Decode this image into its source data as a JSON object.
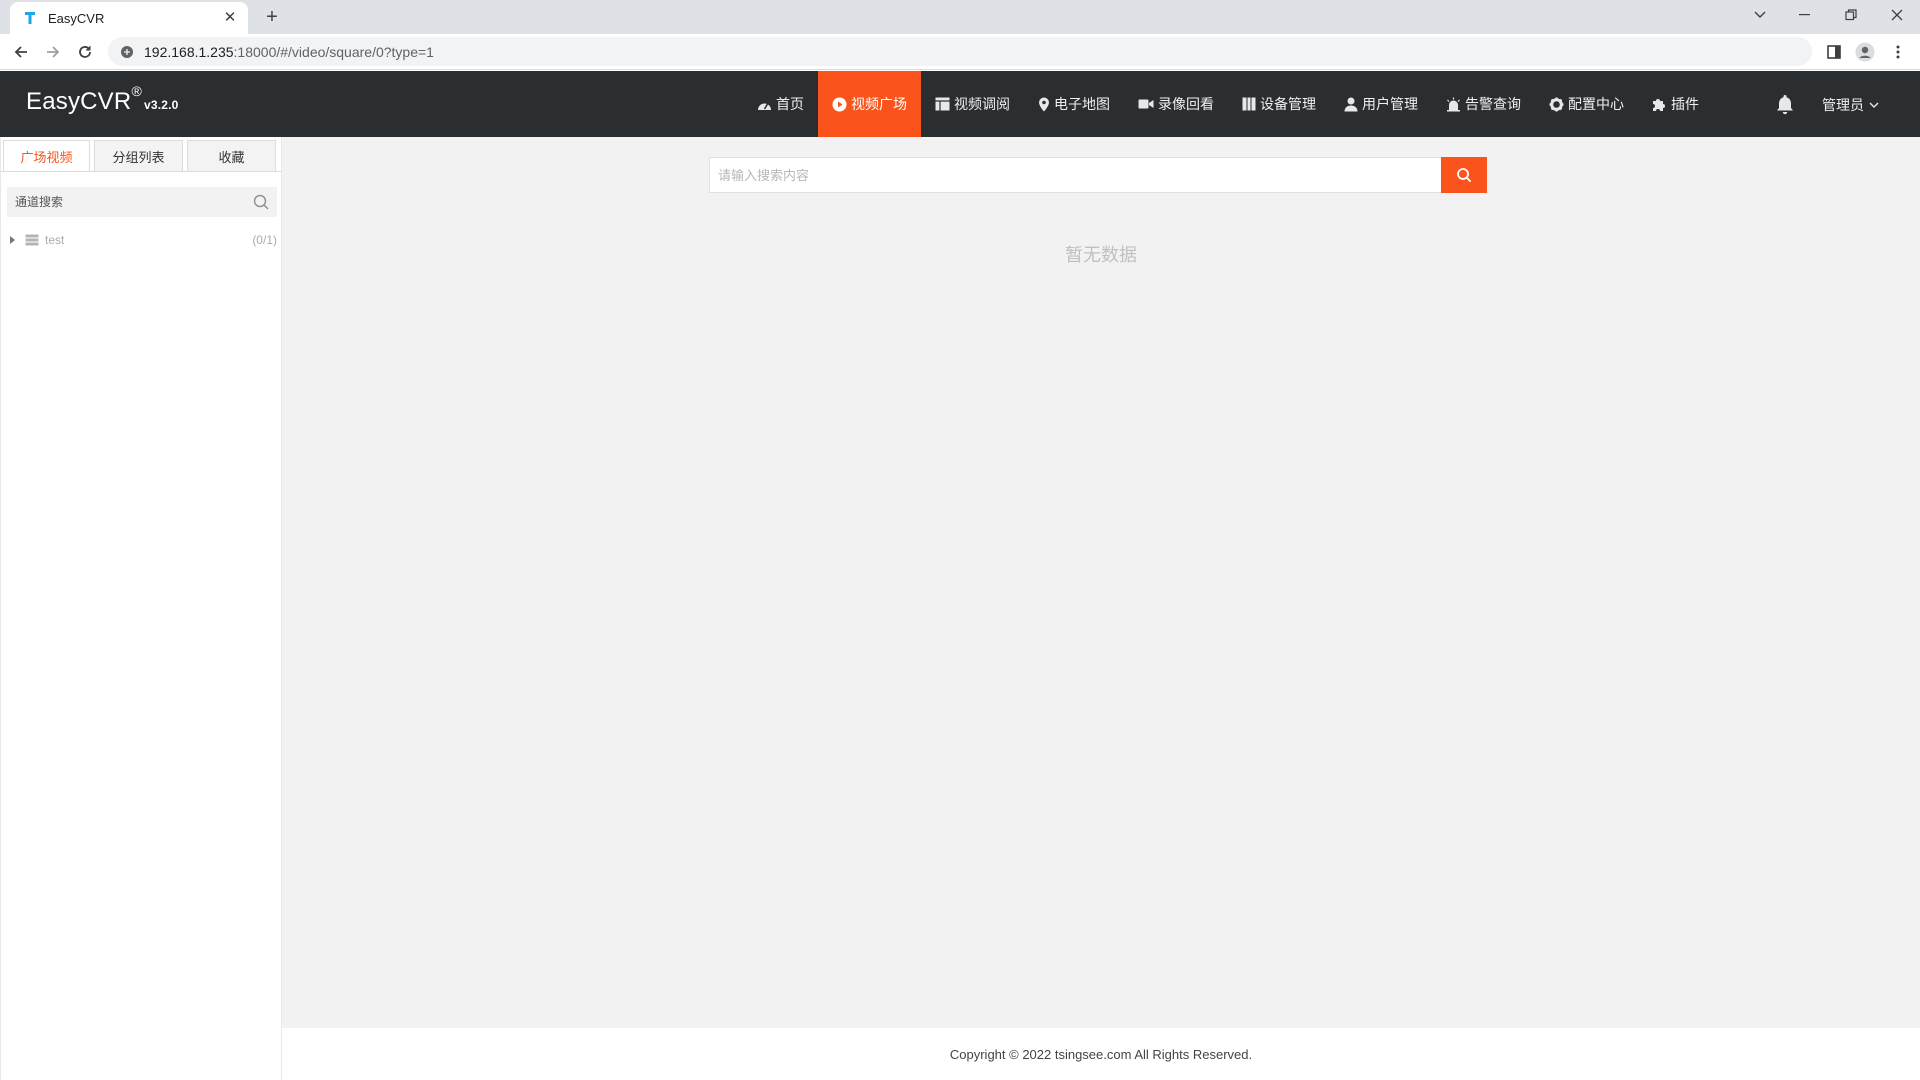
{
  "browser": {
    "tab_title": "EasyCVR",
    "new_tab": "+",
    "url_host": "192.168.1.235",
    "url_path": ":18000/#/video/square/0?type=1"
  },
  "header": {
    "logo": "EasyCVR",
    "logo_mark": "®",
    "version": "v3.2.0",
    "nav": [
      {
        "label": "首页",
        "icon": "dashboard-icon"
      },
      {
        "label": "视频广场",
        "icon": "play-circle-icon",
        "active": true
      },
      {
        "label": "视频调阅",
        "icon": "layout-icon"
      },
      {
        "label": "电子地图",
        "icon": "map-pin-icon"
      },
      {
        "label": "录像回看",
        "icon": "video-camera-icon"
      },
      {
        "label": "设备管理",
        "icon": "device-icon"
      },
      {
        "label": "用户管理",
        "icon": "user-icon"
      },
      {
        "label": "告警查询",
        "icon": "alarm-icon"
      },
      {
        "label": "配置中心",
        "icon": "gear-icon"
      },
      {
        "label": "插件",
        "icon": "puzzle-icon"
      }
    ],
    "user": "管理员",
    "accent_color": "#fa541c"
  },
  "sidebar": {
    "tabs": [
      "广场视频",
      "分组列表",
      "收藏"
    ],
    "search_placeholder": "通道搜索",
    "tree": [
      {
        "label": "test",
        "count": "(0/1)"
      }
    ]
  },
  "main": {
    "search_placeholder": "请输入搜索内容",
    "empty_text": "暂无数据"
  },
  "footer": {
    "copyright": "Copyright © 2022 tsingsee.com All Rights Reserved."
  }
}
